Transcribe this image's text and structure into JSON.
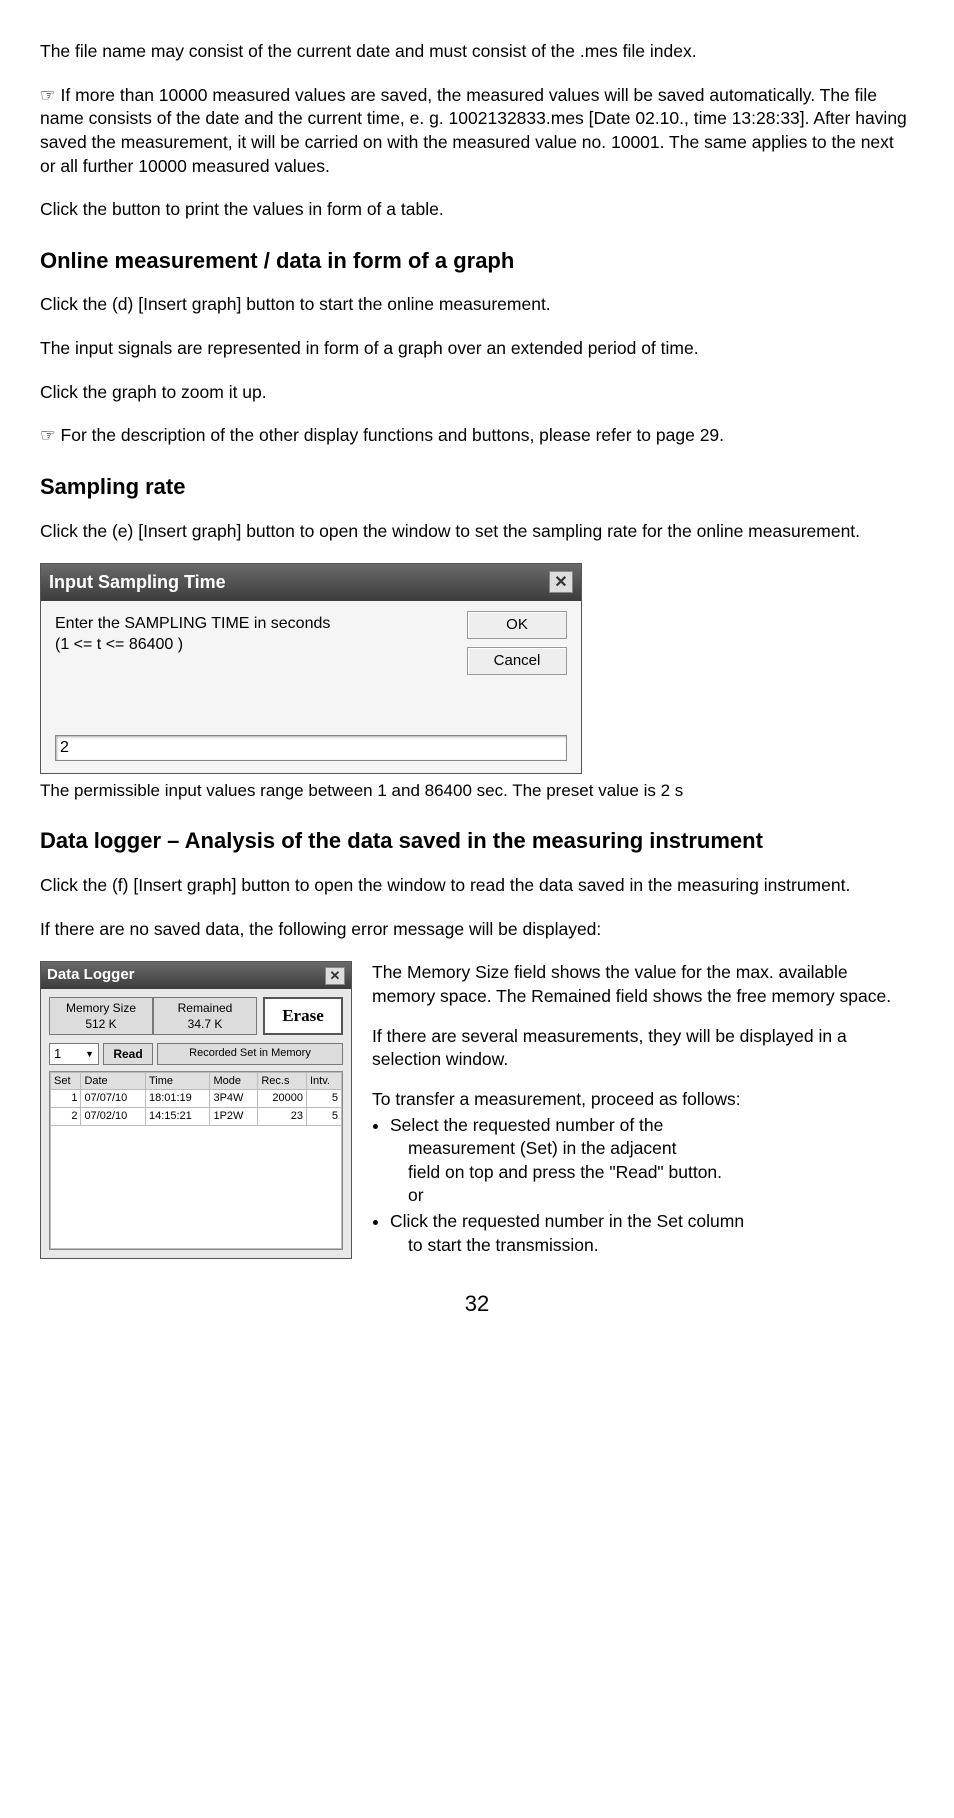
{
  "p1": "The file name may consist of the current date and must consist of the .mes file index.",
  "p2": "☞ If more than 10000 measured values are saved, the measured values will be saved automatically. The file name consists of the date and the current time, e. g. 1002132833.mes [Date 02.10., time 13:28:33]. After having saved the measurement, it will be carried on with the measured value no. 10001. The same applies to the next or all further 10000 measured values.",
  "p3": "Click the button to print the values in form of a table.",
  "h1": "Online measurement / data in form of a graph",
  "p4": "Click the (d) [Insert graph] button to start the online measurement.",
  "p5": "The input signals are represented in form of a graph over an extended period of time.",
  "p6": "Click the graph to zoom it up.",
  "p7": "☞ For the description of the other display functions and buttons, please refer to page 29.",
  "h2": "Sampling rate",
  "p8": "Click the (e) [Insert graph] button to open the window to set the sampling rate for the online measurement.",
  "sampling": {
    "title": "Input Sampling Time",
    "close": "✕",
    "prompt1": "Enter the SAMPLING TIME in seconds",
    "prompt2": "(1 <= t <= 86400 )",
    "ok": "OK",
    "cancel": "Cancel",
    "value": "2"
  },
  "caption1": "The permissible input values range between 1 and 86400 sec. The preset value is 2 s",
  "h3": "Data logger – Analysis of the data saved in the measuring instrument",
  "p9": "Click the (f) [Insert graph] button to open the window to read the data saved in the measuring instrument.",
  "p10": "If there are no saved data, the following error message will be displayed:",
  "logger": {
    "title": "Data Logger",
    "close": "✕",
    "memsize_lbl": "Memory Size",
    "memsize_val": "512 K",
    "remained_lbl": "Remained",
    "remained_val": "34.7 K",
    "erase": "Erase",
    "select_val": "1",
    "read": "Read",
    "recset": "Recorded Set in Memory",
    "cols": {
      "c0": "Set",
      "c1": "Date",
      "c2": "Time",
      "c3": "Mode",
      "c4": "Rec.s",
      "c5": "Intv."
    },
    "rows": [
      {
        "set": "1",
        "date": "07/07/10",
        "time": "18:01:19",
        "mode": "3P4W",
        "recs": "20000",
        "intv": "5"
      },
      {
        "set": "2",
        "date": "07/02/10",
        "time": "14:15:21",
        "mode": "1P2W",
        "recs": "23",
        "intv": "5"
      }
    ]
  },
  "r1": "The Memory Size field shows the value for the max. available memory space. The Remained field shows the free memory space.",
  "r2": "If there are several measurements, they will be displayed in a selection window.",
  "r3": "To transfer a measurement, proceed as follows:",
  "b1a": "Select the requested number of the",
  "b1b": "measurement (Set) in the adjacent",
  "b1c": "field on top and press the \"Read\" button.",
  "b1d": "or",
  "b2a": "Click the requested number in the Set column",
  "b2b": "to start the transmission.",
  "page": "32"
}
